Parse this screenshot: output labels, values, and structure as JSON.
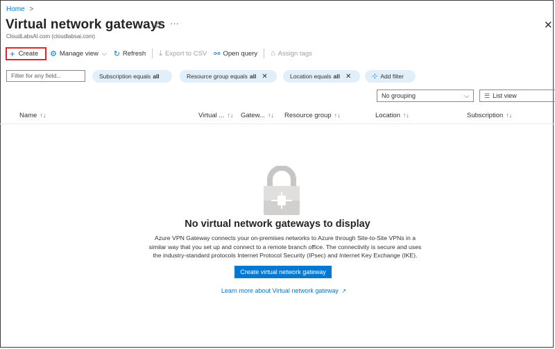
{
  "breadcrumb": {
    "home": "Home",
    "separator": ">"
  },
  "header": {
    "title": "Virtual network gateways",
    "subtitle": "CloudLabsAI.com (cloudlabsai.com)",
    "pin_icon": "pin-icon",
    "more": "···",
    "close": "✕"
  },
  "toolbar": {
    "create": "Create",
    "manage_view": "Manage view",
    "refresh": "Refresh",
    "export_csv": "Export to CSV",
    "open_query": "Open query",
    "assign_tags": "Assign tags"
  },
  "filters": {
    "placeholder": "Filter for any field...",
    "pills": [
      {
        "label": "Subscription equals",
        "value": "all"
      },
      {
        "label": "Resource group equals",
        "value": "all"
      },
      {
        "label": "Location equals",
        "value": "all"
      }
    ],
    "add_filter": "Add filter"
  },
  "view": {
    "grouping": "No grouping",
    "list_view": "List view"
  },
  "table": {
    "columns": [
      "Name",
      "Virtual ...",
      "Gatew...",
      "Resource group",
      "Location",
      "Subscription"
    ]
  },
  "empty_state": {
    "title": "No virtual network gateways to display",
    "description": "Azure VPN Gateway connects your on-premises networks to Azure through Site-to-Site VPNs in a similar way that you set up and connect to a remote branch office. The connectivity is secure and uses the industry-standard protocols Internet Protocol Security (IPsec) and Internet Key Exchange (IKE).",
    "button": "Create virtual network gateway",
    "link": "Learn more about Virtual network gateway"
  },
  "colors": {
    "accent": "#0078d4",
    "create_highlight": "#e0252b",
    "pill_bg": "#e1effa"
  }
}
